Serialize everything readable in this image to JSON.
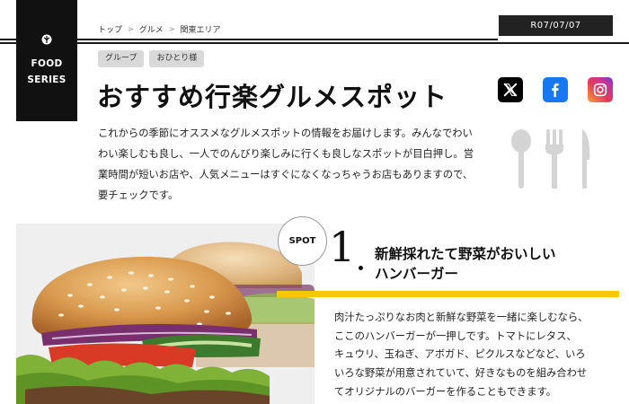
{
  "series": {
    "line1": "FOOD",
    "line2": "SERIES",
    "icon": "leaf-icon"
  },
  "breadcrumb": [
    "トップ",
    "グルメ",
    "関東エリア"
  ],
  "date": "R07/07/07",
  "tags": [
    "グループ",
    "おひとり様"
  ],
  "title": "おすすめ行楽グルメスポット",
  "social": [
    {
      "name": "x",
      "icon": "x-logo-icon"
    },
    {
      "name": "facebook",
      "icon": "facebook-icon"
    },
    {
      "name": "instagram",
      "icon": "instagram-icon"
    }
  ],
  "intro": [
    "これからの季節にオススメなグルメスポットの情報をお届けします。みんなでわい",
    "わい楽しむも良し、一人でのんびり楽しみに行くも良しなスポットが目白押し。営",
    "業時間が短いお店や、人気メニューはすぐになくなっちゃうお店もありますので、",
    "要チェックです。"
  ],
  "decor": {
    "icon": "cutlery-icon"
  },
  "spot": {
    "badge": "SPOT",
    "number": "1",
    "title_line1": "新鮮採れたて野菜がおいしい",
    "title_line2": "ハンバーガー",
    "body": [
      "肉汁たっぷりなお肉と新鮮な野菜を一緒に楽しむなら、",
      "ここのハンバーガーが一押しです。トマトにレタス、",
      "キュウリ、玉ねぎ、アボガド、ピクルスなどなど、いろ",
      "いろな野菜が用意されていて、好きなものを組み合わせ",
      "てオリジナルのバーガーを作ることもできます。"
    ],
    "image": "hamburger-photo"
  },
  "colors": {
    "accent": "#f5c800",
    "dark": "#111111",
    "tag_bg": "#d9d9d9"
  }
}
